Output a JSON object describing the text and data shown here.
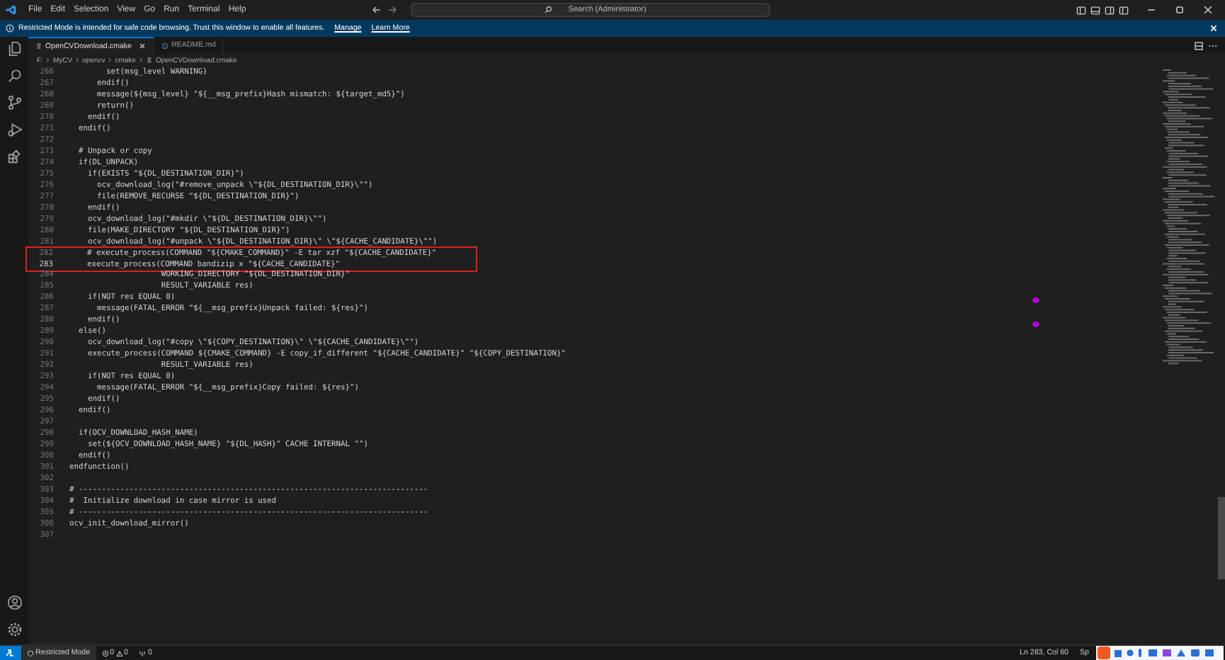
{
  "menu": [
    "File",
    "Edit",
    "Selection",
    "View",
    "Go",
    "Run",
    "Terminal",
    "Help"
  ],
  "search": {
    "placeholder": "Search (Administrator)"
  },
  "banner": {
    "text": "Restricted Mode is intended for safe code browsing. Trust this window to enable all features.",
    "links": [
      "Manage",
      "Learn More"
    ]
  },
  "tabs": [
    {
      "label": "OpenCVDownload.cmake",
      "selected": true,
      "kind": "cmake"
    },
    {
      "label": "README.md",
      "selected": false,
      "kind": "info"
    }
  ],
  "breadcrumbs": [
    "F:",
    "MyCV",
    "opencv",
    "cmake",
    "OpenCVDownload.cmake"
  ],
  "lines": [
    {
      "n": "266",
      "text": "        set(msg_level WARNING)",
      "current": false,
      "boxed": false
    },
    {
      "n": "267",
      "text": "      endif()",
      "current": false,
      "boxed": false
    },
    {
      "n": "268",
      "text": "      message(${msg_level} \"${__msg_prefix}Hash mismatch: ${target_md5}\")",
      "current": false,
      "boxed": false
    },
    {
      "n": "269",
      "text": "      return()",
      "current": false,
      "boxed": false
    },
    {
      "n": "270",
      "text": "    endif()",
      "current": false,
      "boxed": false
    },
    {
      "n": "271",
      "text": "  endif()",
      "current": false,
      "boxed": false
    },
    {
      "n": "272",
      "current": false,
      "boxed": false
    },
    {
      "n": "273",
      "text": "  # Unpack or copy",
      "current": false,
      "boxed": false
    },
    {
      "n": "274",
      "text": "  if(DL_UNPACK)",
      "current": false,
      "boxed": false
    },
    {
      "n": "275",
      "text": "    if(EXISTS \"${DL_DESTINATION_DIR}\")",
      "current": false,
      "boxed": false
    },
    {
      "n": "276",
      "text": "      ocv_download_log(\"#remove_unpack \\\"${DL_DESTINATION_DIR}\\\"\")",
      "current": false,
      "boxed": false
    },
    {
      "n": "277",
      "text": "      file(REMOVE_RECURSE \"${DL_DESTINATION_DIR}\")",
      "current": false,
      "boxed": false
    },
    {
      "n": "278",
      "text": "    endif()",
      "current": false,
      "boxed": false
    },
    {
      "n": "279",
      "text": "    ocv_download_log(\"#mkdir \\\"${DL_DESTINATION_DIR}\\\"\")",
      "current": false,
      "boxed": false
    },
    {
      "n": "280",
      "text": "    file(MAKE_DIRECTORY \"${DL_DESTINATION_DIR}\")",
      "current": false,
      "boxed": false
    },
    {
      "n": "281",
      "text": "    ocv_download_log(\"#unpack \\\"${DL_DESTINATION_DIR}\\\" \\\"${CACHE_CANDIDATE}\\\"\")",
      "current": false,
      "boxed": false
    },
    {
      "n": "282",
      "text": "    # execute_process(COMMAND \"${CMAKE_COMMAND}\" -E tar xzf \"${CACHE_CANDIDATE}\"",
      "current": false,
      "boxed": true
    },
    {
      "n": "283",
      "text": "    execute_process(COMMAND bandizip x \"${CACHE_CANDIDATE}\"",
      "current": true,
      "boxed": true
    },
    {
      "n": "284",
      "text": "                    WORKING_DIRECTORY \"${DL_DESTINATION_DIR}\"",
      "current": false,
      "boxed": false
    },
    {
      "n": "285",
      "text": "                    RESULT_VARIABLE res)",
      "current": false,
      "boxed": false
    },
    {
      "n": "286",
      "text": "    if(NOT res EQUAL 0)",
      "current": false,
      "boxed": false
    },
    {
      "n": "287",
      "text": "      message(FATAL_ERROR \"${__msg_prefix}Unpack failed: ${res}\")",
      "current": false,
      "boxed": false
    },
    {
      "n": "288",
      "text": "    endif()",
      "current": false,
      "boxed": false
    },
    {
      "n": "289",
      "text": "  else()",
      "current": false,
      "boxed": false
    },
    {
      "n": "290",
      "text": "    ocv_download_log(\"#copy \\\"${COPY_DESTINATION}\\\" \\\"${CACHE_CANDIDATE}\\\"\")",
      "current": false,
      "boxed": false
    },
    {
      "n": "291",
      "text": "    execute_process(COMMAND ${CMAKE_COMMAND} -E copy_if_different \"${CACHE_CANDIDATE}\" \"${COPY_DESTINATION}\"",
      "current": false,
      "boxed": false
    },
    {
      "n": "292",
      "text": "                    RESULT_VARIABLE res)",
      "current": false,
      "boxed": false
    },
    {
      "n": "293",
      "text": "    if(NOT res EQUAL 0)",
      "current": false,
      "boxed": false
    },
    {
      "n": "294",
      "text": "      message(FATAL_ERROR \"${__msg_prefix}Copy failed: ${res}\")",
      "current": false,
      "boxed": false
    },
    {
      "n": "295",
      "text": "    endif()",
      "current": false,
      "boxed": false
    },
    {
      "n": "296",
      "text": "  endif()",
      "current": false,
      "boxed": false
    },
    {
      "n": "297",
      "current": false,
      "boxed": false
    },
    {
      "n": "298",
      "text": "  if(OCV_DOWNLOAD_HASH_NAME)",
      "current": false,
      "boxed": false
    },
    {
      "n": "299",
      "text": "    set(${OCV_DOWNLOAD_HASH_NAME} \"${DL_HASH}\" CACHE INTERNAL \"\")",
      "current": false,
      "boxed": false
    },
    {
      "n": "300",
      "text": "  endif()",
      "current": false,
      "boxed": false
    },
    {
      "n": "301",
      "text": "endfunction()",
      "current": false,
      "boxed": false
    },
    {
      "n": "302",
      "current": false,
      "boxed": false
    },
    {
      "n": "303",
      "text": "# ----------------------------------------------------------------------------",
      "current": false,
      "boxed": false
    },
    {
      "n": "304",
      "text": "#  Initialize download in case mirror is used",
      "current": false,
      "boxed": false
    },
    {
      "n": "305",
      "text": "# ----------------------------------------------------------------------------",
      "current": false,
      "boxed": false
    },
    {
      "n": "306",
      "text": "ocv_init_download_mirror()",
      "current": false,
      "boxed": false
    },
    {
      "n": "307",
      "current": false,
      "boxed": false
    }
  ],
  "status": {
    "restricted": "Restricted Mode",
    "errors": "0",
    "warnings": "0",
    "ports": "0",
    "position": "Ln 283, Col 60",
    "spaces": "Sp"
  }
}
